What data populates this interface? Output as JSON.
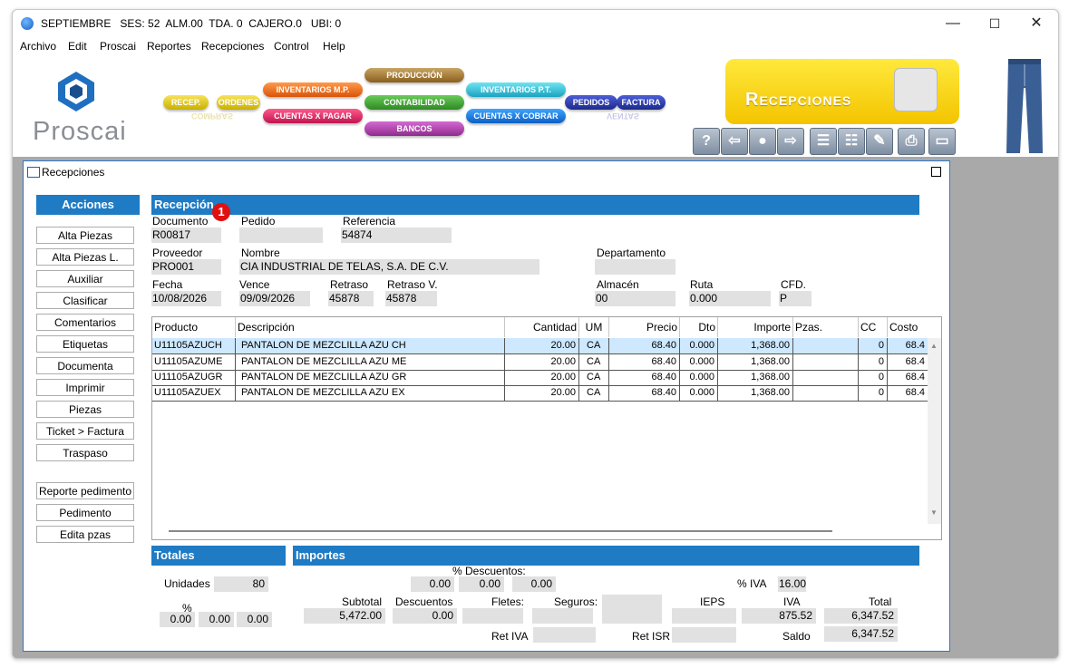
{
  "window": {
    "title": "SEPTIEMBRE   SES: 52  ALM.00  TDA. 0  CAJERO.0   UBI: 0",
    "minimize": "—",
    "maximize": "☐",
    "close": "✕"
  },
  "menu": [
    "Archivo",
    "Edit",
    "Proscai",
    "Reportes",
    "Recepciones",
    "Control",
    "Help"
  ],
  "logo": {
    "text": "Proscai"
  },
  "modules": {
    "recep": "RECEP.",
    "ordenes": "ORDENES",
    "compras": "COMPRAS",
    "inventarios_mp": "INVENTARIOS M.P.",
    "cuentas_pagar": "CUENTAS X PAGAR",
    "produccion": "PRODUCCIÓN",
    "contabilidad": "CONTABILIDAD",
    "bancos": "BANCOS",
    "inventarios_pt": "INVENTARIOS P.T.",
    "cuentas_cobrar": "CUENTAS X COBRAR",
    "pedidos": "PEDIDOS",
    "factura": "FACTURA",
    "ventas": "VENTAS"
  },
  "banner_title": "Recepciones",
  "toolbar_icons": [
    "help-icon",
    "back-arrow-icon",
    "search-icon",
    "forward-arrow-icon",
    "list-icon",
    "edit-list-icon",
    "edit-icon",
    "print-icon",
    "window-icon"
  ],
  "inner": {
    "title": "Recepciones",
    "acciones": "Acciones",
    "actions1": [
      "Alta Piezas",
      "Alta Piezas L.",
      "Auxiliar",
      "Clasificar",
      "Comentarios",
      "Etiquetas",
      "Documenta",
      "Imprimir",
      "Piezas",
      "Ticket > Factura",
      "Traspaso"
    ],
    "actions2": [
      "Reporte pedimento",
      "Pedimento",
      "Edita pzas"
    ]
  },
  "recepcion": {
    "header": "Recepción",
    "badge": "1",
    "documento": {
      "label": "Documento",
      "value": "R00817"
    },
    "pedido": {
      "label": "Pedido",
      "value": ""
    },
    "referencia": {
      "label": "Referencia",
      "value": "54874"
    },
    "proveedor": {
      "label": "Proveedor",
      "value": "PRO001"
    },
    "nombre": {
      "label": "Nombre",
      "value": "CIA INDUSTRIAL DE TELAS, S.A. DE C.V."
    },
    "departamento": {
      "label": "Departamento",
      "value": ""
    },
    "fecha": {
      "label": "Fecha",
      "value": "10/08/2026"
    },
    "vence": {
      "label": "Vence",
      "value": "09/09/2026"
    },
    "retraso": {
      "label": "Retraso",
      "value": "45878"
    },
    "retraso_v": {
      "label": "Retraso V.",
      "value": "45878"
    },
    "almacen": {
      "label": "Almacén",
      "value": "00"
    },
    "ruta": {
      "label": "Ruta",
      "value": "0.000"
    },
    "cfd": {
      "label": "CFD.",
      "value": "P"
    }
  },
  "grid": {
    "columns": [
      "Producto",
      "Descripción",
      "Cantidad",
      "UM",
      "Precio",
      "Dto",
      "Importe",
      "Pzas.",
      "CC",
      "Costo"
    ],
    "rows": [
      [
        "U11105AZUCH",
        "PANTALON DE MEZCLILLA AZU CH",
        "20.00",
        "CA",
        "68.40",
        "0.000",
        "1,368.00",
        "",
        "0",
        "68.4"
      ],
      [
        "U11105AZUME",
        "PANTALON DE MEZCLILLA AZU ME",
        "20.00",
        "CA",
        "68.40",
        "0.000",
        "1,368.00",
        "",
        "0",
        "68.4"
      ],
      [
        "U11105AZUGR",
        "PANTALON DE MEZCLILLA AZU GR",
        "20.00",
        "CA",
        "68.40",
        "0.000",
        "1,368.00",
        "",
        "0",
        "68.4"
      ],
      [
        "U11105AZUEX",
        "PANTALON DE MEZCLILLA AZU EX",
        "20.00",
        "CA",
        "68.40",
        "0.000",
        "1,368.00",
        "",
        "0",
        "68.4"
      ]
    ]
  },
  "totales": {
    "header": "Totales",
    "unidades_label": "Unidades",
    "unidades": "80",
    "pct_label": "%",
    "pct1": "0.00",
    "pct2": "0.00",
    "pct3": "0.00"
  },
  "importes": {
    "header": "Importes",
    "descuentos_pct_label": "% Descuentos:",
    "d1": "0.00",
    "d2": "0.00",
    "d3": "0.00",
    "iva_pct_label": "% IVA",
    "iva_pct": "16.00",
    "subtotal_label": "Subtotal",
    "subtotal": "5,472.00",
    "descuentos_label": "Descuentos",
    "descuentos": "0.00",
    "fletes_label": "Fletes:",
    "fletes": "",
    "seguros_label": "Seguros:",
    "seguros": "",
    "ieps_label": "IEPS",
    "ieps": "",
    "iva_label": "IVA",
    "iva": "875.52",
    "total_label": "Total",
    "total": "6,347.52",
    "ret_iva_label": "Ret IVA",
    "ret_iva": "",
    "ret_isr_label": "Ret ISR",
    "ret_isr": "",
    "saldo_label": "Saldo",
    "saldo": "6,347.52"
  }
}
